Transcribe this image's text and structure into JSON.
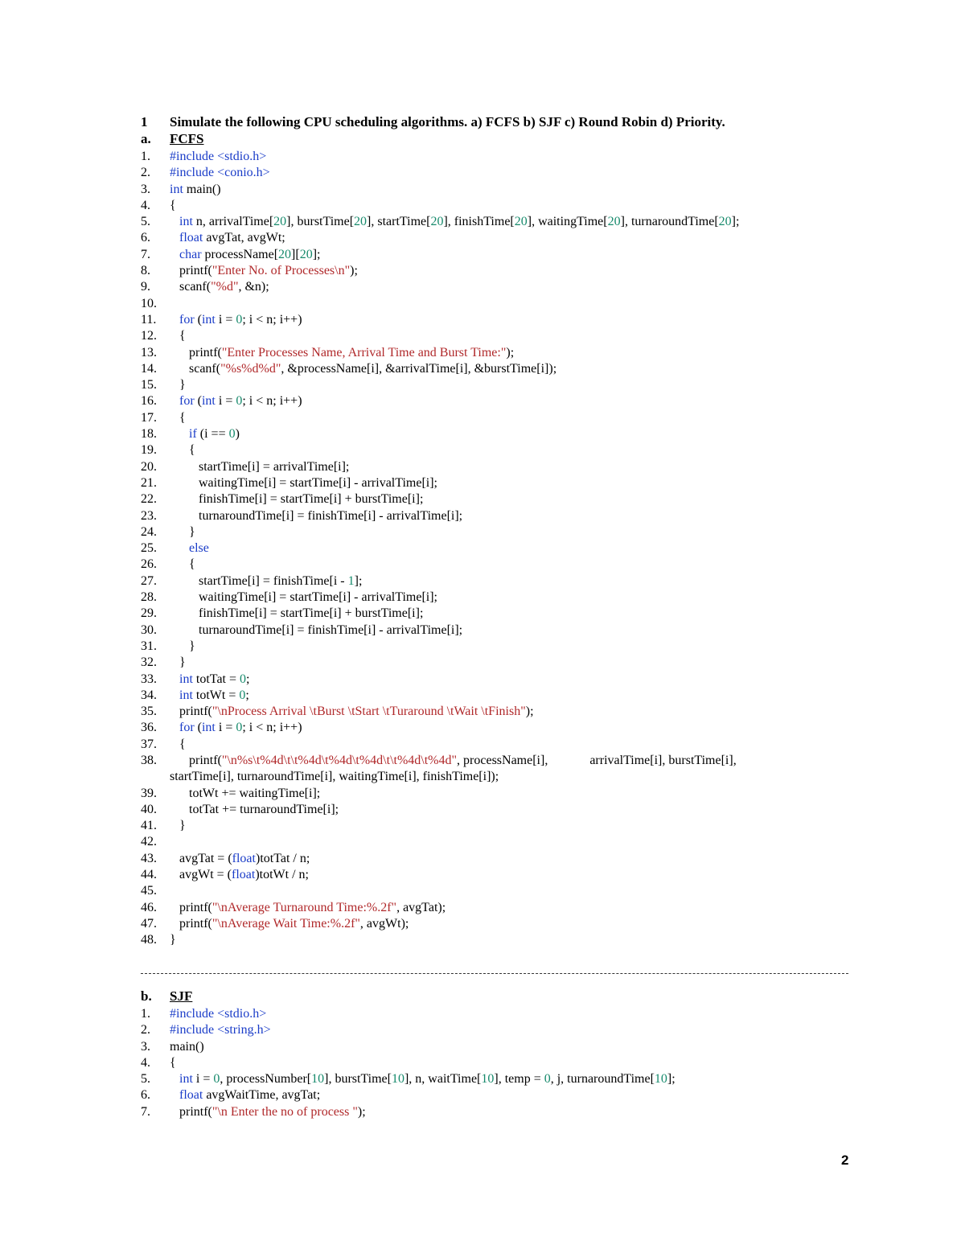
{
  "heading": {
    "number": "1",
    "text": "Simulate the following CPU scheduling algorithms. a) FCFS b) SJF c) Round Robin d) Priority."
  },
  "sections": {
    "fcfs": {
      "letter": "a.",
      "title": "FCFS"
    },
    "sjf": {
      "letter": "b.",
      "title": "SJF"
    }
  },
  "fcfs_code": [
    {
      "n": "1.",
      "t": [
        [
          "pp",
          "#include <stdio.h>"
        ]
      ]
    },
    {
      "n": "2.",
      "t": [
        [
          "pp",
          "#include <conio.h>"
        ]
      ]
    },
    {
      "n": "3.",
      "t": [
        [
          "kw",
          "int"
        ],
        [
          "p",
          " main()"
        ]
      ]
    },
    {
      "n": "4.",
      "t": [
        [
          "p",
          "{"
        ]
      ]
    },
    {
      "n": "5.",
      "t": [
        [
          "p",
          "   "
        ],
        [
          "kw",
          "int"
        ],
        [
          "p",
          " n, arrivalTime["
        ],
        [
          "num",
          "20"
        ],
        [
          "p",
          "], burstTime["
        ],
        [
          "num",
          "20"
        ],
        [
          "p",
          "], startTime["
        ],
        [
          "num",
          "20"
        ],
        [
          "p",
          "], finishTime["
        ],
        [
          "num",
          "20"
        ],
        [
          "p",
          "], waitingTime["
        ],
        [
          "num",
          "20"
        ],
        [
          "p",
          "], turnaroundTime["
        ],
        [
          "num",
          "20"
        ],
        [
          "p",
          "];"
        ]
      ]
    },
    {
      "n": "6.",
      "t": [
        [
          "p",
          "   "
        ],
        [
          "kw",
          "float"
        ],
        [
          "p",
          " avgTat, avgWt;"
        ]
      ]
    },
    {
      "n": "7.",
      "t": [
        [
          "p",
          "   "
        ],
        [
          "kw",
          "char"
        ],
        [
          "p",
          " processName["
        ],
        [
          "num",
          "20"
        ],
        [
          "p",
          "]["
        ],
        [
          "num",
          "20"
        ],
        [
          "p",
          "];"
        ]
      ]
    },
    {
      "n": "8.",
      "t": [
        [
          "p",
          "   printf("
        ],
        [
          "str",
          "\"Enter No. of Processes\\n\""
        ],
        [
          "p",
          ");"
        ]
      ]
    },
    {
      "n": "9.",
      "t": [
        [
          "p",
          "   scanf("
        ],
        [
          "str",
          "\"%d\""
        ],
        [
          "p",
          ", &n);"
        ]
      ]
    },
    {
      "n": "10.",
      "t": [
        [
          "p",
          ""
        ]
      ]
    },
    {
      "n": "11.",
      "t": [
        [
          "p",
          "   "
        ],
        [
          "kw",
          "for"
        ],
        [
          "p",
          " ("
        ],
        [
          "kw",
          "int"
        ],
        [
          "p",
          " i = "
        ],
        [
          "num",
          "0"
        ],
        [
          "p",
          "; i < n; i++)"
        ]
      ]
    },
    {
      "n": "12.",
      "t": [
        [
          "p",
          "   {"
        ]
      ]
    },
    {
      "n": "13.",
      "t": [
        [
          "p",
          "      printf("
        ],
        [
          "str",
          "\"Enter Processes Name, Arrival Time and Burst Time:\""
        ],
        [
          "p",
          ");"
        ]
      ]
    },
    {
      "n": "14.",
      "t": [
        [
          "p",
          "      scanf("
        ],
        [
          "str",
          "\"%s%d%d\""
        ],
        [
          "p",
          ", &processName[i], &arrivalTime[i], &burstTime[i]);"
        ]
      ]
    },
    {
      "n": "15.",
      "t": [
        [
          "p",
          "   }"
        ]
      ]
    },
    {
      "n": "16.",
      "t": [
        [
          "p",
          "   "
        ],
        [
          "kw",
          "for"
        ],
        [
          "p",
          " ("
        ],
        [
          "kw",
          "int"
        ],
        [
          "p",
          " i = "
        ],
        [
          "num",
          "0"
        ],
        [
          "p",
          "; i < n; i++)"
        ]
      ]
    },
    {
      "n": "17.",
      "t": [
        [
          "p",
          "   {"
        ]
      ]
    },
    {
      "n": "18.",
      "t": [
        [
          "p",
          "      "
        ],
        [
          "kw",
          "if"
        ],
        [
          "p",
          " (i == "
        ],
        [
          "num",
          "0"
        ],
        [
          "p",
          ")"
        ]
      ]
    },
    {
      "n": "19.",
      "t": [
        [
          "p",
          "      {"
        ]
      ]
    },
    {
      "n": "20.",
      "t": [
        [
          "p",
          "         startTime[i] = arrivalTime[i];"
        ]
      ]
    },
    {
      "n": "21.",
      "t": [
        [
          "p",
          "         waitingTime[i] = startTime[i] - arrivalTime[i];"
        ]
      ]
    },
    {
      "n": "22.",
      "t": [
        [
          "p",
          "         finishTime[i] = startTime[i] + burstTime[i];"
        ]
      ]
    },
    {
      "n": "23.",
      "t": [
        [
          "p",
          "         turnaroundTime[i] = finishTime[i] - arrivalTime[i];"
        ]
      ]
    },
    {
      "n": "24.",
      "t": [
        [
          "p",
          "      }"
        ]
      ]
    },
    {
      "n": "25.",
      "t": [
        [
          "p",
          "      "
        ],
        [
          "kw",
          "else"
        ]
      ]
    },
    {
      "n": "26.",
      "t": [
        [
          "p",
          "      {"
        ]
      ]
    },
    {
      "n": "27.",
      "t": [
        [
          "p",
          "         startTime[i] = finishTime[i - "
        ],
        [
          "num",
          "1"
        ],
        [
          "p",
          "];"
        ]
      ]
    },
    {
      "n": "28.",
      "t": [
        [
          "p",
          "         waitingTime[i] = startTime[i] - arrivalTime[i];"
        ]
      ]
    },
    {
      "n": "29.",
      "t": [
        [
          "p",
          "         finishTime[i] = startTime[i] + burstTime[i];"
        ]
      ]
    },
    {
      "n": "30.",
      "t": [
        [
          "p",
          "         turnaroundTime[i] = finishTime[i] - arrivalTime[i];"
        ]
      ]
    },
    {
      "n": "31.",
      "t": [
        [
          "p",
          "      }"
        ]
      ]
    },
    {
      "n": "32.",
      "t": [
        [
          "p",
          "   }"
        ]
      ]
    },
    {
      "n": "33.",
      "t": [
        [
          "p",
          "   "
        ],
        [
          "kw",
          "int"
        ],
        [
          "p",
          " totTat = "
        ],
        [
          "num",
          "0"
        ],
        [
          "p",
          ";"
        ]
      ]
    },
    {
      "n": "34.",
      "t": [
        [
          "p",
          "   "
        ],
        [
          "kw",
          "int"
        ],
        [
          "p",
          " totWt = "
        ],
        [
          "num",
          "0"
        ],
        [
          "p",
          ";"
        ]
      ]
    },
    {
      "n": "35.",
      "t": [
        [
          "p",
          "   printf("
        ],
        [
          "str",
          "\"\\nProcess Arrival \\tBurst \\tStart \\tTuraround \\tWait \\tFinish\""
        ],
        [
          "p",
          ");"
        ]
      ]
    },
    {
      "n": "36.",
      "t": [
        [
          "p",
          "   "
        ],
        [
          "kw",
          "for"
        ],
        [
          "p",
          " ("
        ],
        [
          "kw",
          "int"
        ],
        [
          "p",
          " i = "
        ],
        [
          "num",
          "0"
        ],
        [
          "p",
          "; i < n; i++)"
        ]
      ]
    },
    {
      "n": "37.",
      "t": [
        [
          "p",
          "   {"
        ]
      ]
    },
    {
      "n": "38.",
      "t": [
        [
          "p",
          "      printf("
        ],
        [
          "str",
          "\"\\n%s\\t%4d\\t\\t%4d\\t%4d\\t%4d\\t\\t%4d\\t%4d\""
        ],
        [
          "p",
          ", processName[i],"
        ],
        [
          "gap",
          ""
        ],
        [
          "p",
          "arrivalTime[i], burstTime[i],"
        ]
      ]
    },
    {
      "n": "",
      "t": [
        [
          "p",
          "startTime[i], turnaroundTime[i], waitingTime[i], finishTime[i]);"
        ]
      ]
    },
    {
      "n": "39.",
      "t": [
        [
          "p",
          "      totWt += waitingTime[i];"
        ]
      ]
    },
    {
      "n": "40.",
      "t": [
        [
          "p",
          "      totTat += turnaroundTime[i];"
        ]
      ]
    },
    {
      "n": "41.",
      "t": [
        [
          "p",
          "   }"
        ]
      ]
    },
    {
      "n": "42.",
      "t": [
        [
          "p",
          ""
        ]
      ]
    },
    {
      "n": "43.",
      "t": [
        [
          "p",
          "   avgTat = ("
        ],
        [
          "kw",
          "float"
        ],
        [
          "p",
          ")totTat / n;"
        ]
      ]
    },
    {
      "n": "44.",
      "t": [
        [
          "p",
          "   avgWt = ("
        ],
        [
          "kw",
          "float"
        ],
        [
          "p",
          ")totWt / n;"
        ]
      ]
    },
    {
      "n": "45.",
      "t": [
        [
          "p",
          ""
        ]
      ]
    },
    {
      "n": "46.",
      "t": [
        [
          "p",
          "   printf("
        ],
        [
          "str",
          "\"\\nAverage Turnaround Time:%.2f\""
        ],
        [
          "p",
          ", avgTat);"
        ]
      ]
    },
    {
      "n": "47.",
      "t": [
        [
          "p",
          "   printf("
        ],
        [
          "str",
          "\"\\nAverage Wait Time:%.2f\""
        ],
        [
          "p",
          ", avgWt);"
        ]
      ]
    },
    {
      "n": "48.",
      "t": [
        [
          "p",
          "}"
        ]
      ]
    }
  ],
  "sjf_code": [
    {
      "n": "1.",
      "t": [
        [
          "pp",
          "#include <stdio.h>"
        ]
      ]
    },
    {
      "n": "2.",
      "t": [
        [
          "pp",
          "#include <string.h>"
        ]
      ]
    },
    {
      "n": "3.",
      "t": [
        [
          "p",
          "main()"
        ]
      ]
    },
    {
      "n": "4.",
      "t": [
        [
          "p",
          "{"
        ]
      ]
    },
    {
      "n": "5.",
      "t": [
        [
          "p",
          "   "
        ],
        [
          "kw",
          "int"
        ],
        [
          "p",
          " i = "
        ],
        [
          "num",
          "0"
        ],
        [
          "p",
          ", processNumber["
        ],
        [
          "num",
          "10"
        ],
        [
          "p",
          "], burstTime["
        ],
        [
          "num",
          "10"
        ],
        [
          "p",
          "], n, waitTime["
        ],
        [
          "num",
          "10"
        ],
        [
          "p",
          "], temp = "
        ],
        [
          "num",
          "0"
        ],
        [
          "p",
          ", j, turnaroundTime["
        ],
        [
          "num",
          "10"
        ],
        [
          "p",
          "];"
        ]
      ]
    },
    {
      "n": "6.",
      "t": [
        [
          "p",
          "   "
        ],
        [
          "kw",
          "float"
        ],
        [
          "p",
          " avgWaitTime, avgTat;"
        ]
      ]
    },
    {
      "n": "7.",
      "t": [
        [
          "p",
          "   printf("
        ],
        [
          "str",
          "\"\\n Enter the no of process \""
        ],
        [
          "p",
          ");"
        ]
      ]
    }
  ],
  "page_number": "2"
}
